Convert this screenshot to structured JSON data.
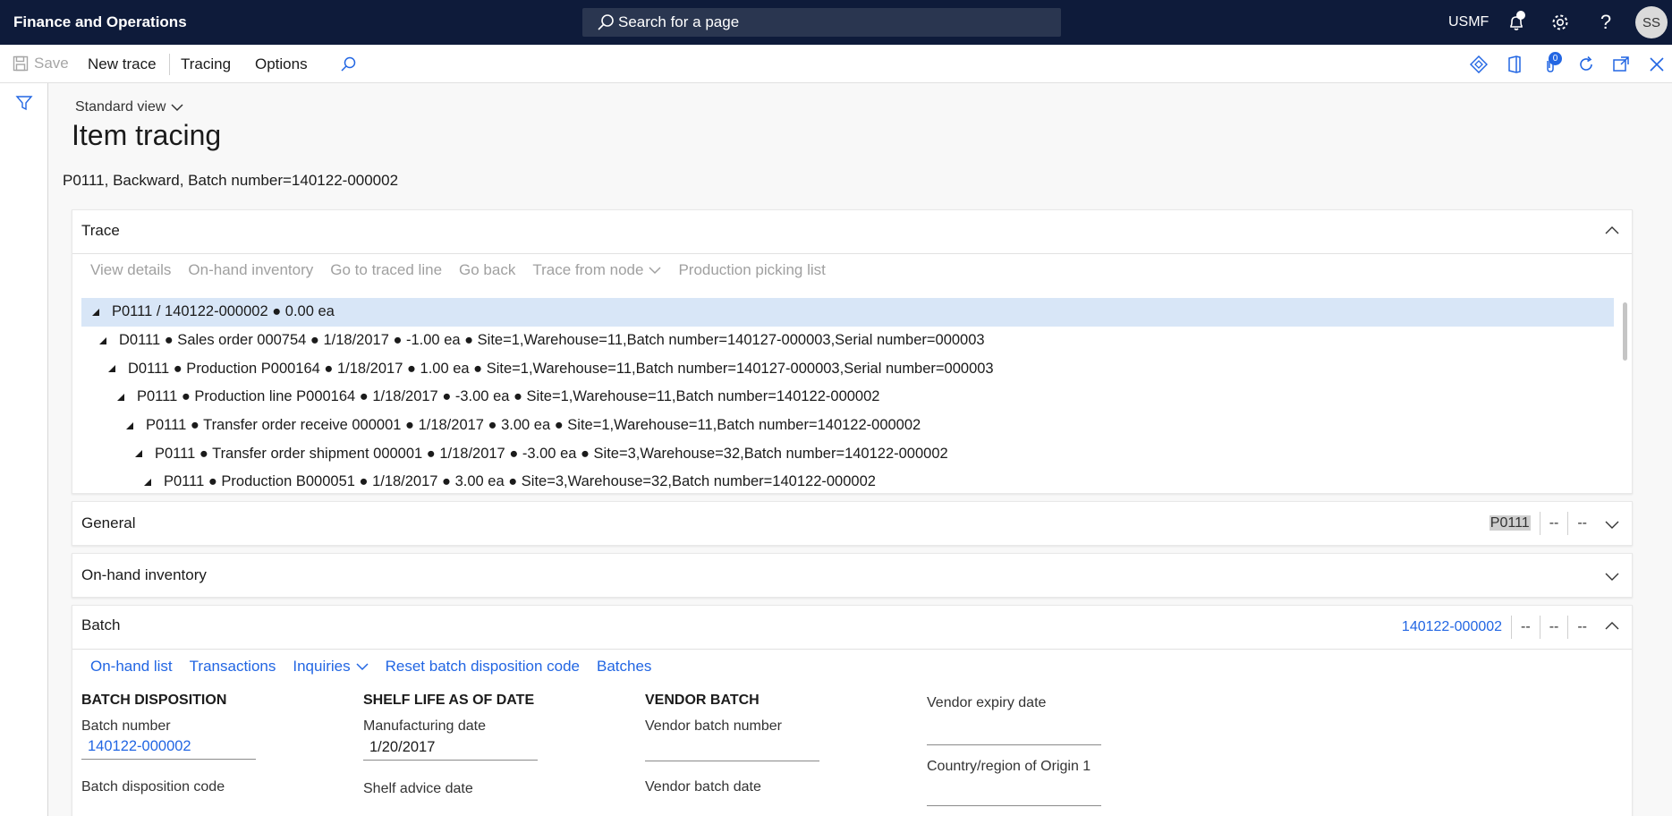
{
  "topbar": {
    "app_title": "Finance and Operations",
    "search_placeholder": "Search for a page",
    "company": "USMF",
    "avatar_initials": "SS",
    "icons": [
      "bell-icon",
      "gear-icon",
      "help-icon"
    ]
  },
  "actionbar": {
    "save": "Save",
    "new_trace": "New trace",
    "tracing": "Tracing",
    "options": "Options",
    "attachment_count": "0",
    "right_icons": [
      "diamond-icon",
      "office-icon",
      "attachment-icon",
      "refresh-icon",
      "popout-icon",
      "close-icon"
    ]
  },
  "page": {
    "view_name": "Standard view",
    "title": "Item tracing",
    "caption": "P0111, Backward, Batch number=140122-000002"
  },
  "trace": {
    "title": "Trace",
    "toolbar": [
      "View details",
      "On-hand inventory",
      "Go to traced line",
      "Go back",
      "Trace from node",
      "Production picking list"
    ],
    "rows": [
      "P0111 / 140122-000002 ● 0.00 ea",
      "D0111 ● Sales order 000754 ● 1/18/2017 ● -1.00 ea ● Site=1,Warehouse=11,Batch number=140127-000003,Serial number=000003",
      "D0111 ● Production P000164 ● 1/18/2017 ● 1.00 ea ● Site=1,Warehouse=11,Batch number=140127-000003,Serial number=000003",
      "P0111 ● Production line P000164 ● 1/18/2017 ● -3.00 ea ● Site=1,Warehouse=11,Batch number=140122-000002",
      "P0111 ● Transfer order receive 000001 ● 1/18/2017 ● 3.00 ea ● Site=1,Warehouse=11,Batch number=140122-000002",
      "P0111 ● Transfer order shipment 000001 ● 1/18/2017 ● -3.00 ea ● Site=3,Warehouse=32,Batch number=140122-000002",
      "P0111 ● Production B000051 ● 1/18/2017 ● 3.00 ea ● Site=3,Warehouse=32,Batch number=140122-000002"
    ]
  },
  "general": {
    "title": "General",
    "summary": [
      "P0111",
      "--",
      "--"
    ]
  },
  "onhand": {
    "title": "On-hand inventory"
  },
  "batch": {
    "title": "Batch",
    "summary": [
      "140122-000002",
      "--",
      "--",
      "--"
    ],
    "links": [
      "On-hand list",
      "Transactions",
      "Inquiries",
      "Reset batch disposition code",
      "Batches"
    ],
    "batch_disposition": {
      "heading": "BATCH DISPOSITION",
      "batch_number_label": "Batch number",
      "batch_number_value": "140122-000002",
      "disposition_code_label": "Batch disposition code"
    },
    "shelf_life": {
      "heading": "SHELF LIFE AS OF DATE",
      "manufacturing_date_label": "Manufacturing date",
      "manufacturing_date_value": "1/20/2017",
      "shelf_advice_label": "Shelf advice date"
    },
    "vendor_batch": {
      "heading": "VENDOR BATCH",
      "vendor_batch_number_label": "Vendor batch number",
      "vendor_batch_number_value": "",
      "vendor_batch_date_label": "Vendor batch date"
    },
    "vendor_expiry": {
      "vendor_expiry_label": "Vendor expiry date",
      "vendor_expiry_value": "",
      "country_label": "Country/region of Origin 1",
      "country_value": ""
    }
  }
}
